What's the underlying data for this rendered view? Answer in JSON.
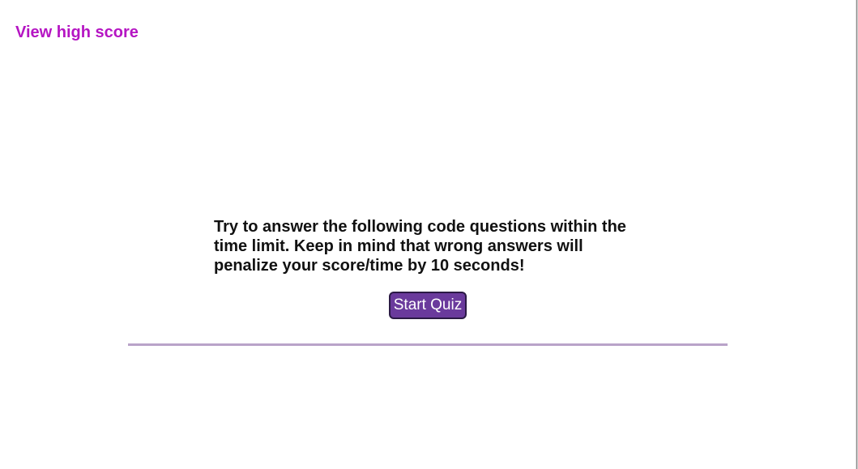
{
  "header": {
    "high_score_link": "View high score"
  },
  "intro": {
    "instructions": "Try to answer the following code questions within the time limit. Keep in mind that wrong answers will penalize your score/time by 10 seconds!",
    "start_button": "Start Quiz"
  },
  "colors": {
    "link": "#b515c3",
    "button_bg": "#6a3a9c",
    "divider": "#b9a3c9"
  }
}
